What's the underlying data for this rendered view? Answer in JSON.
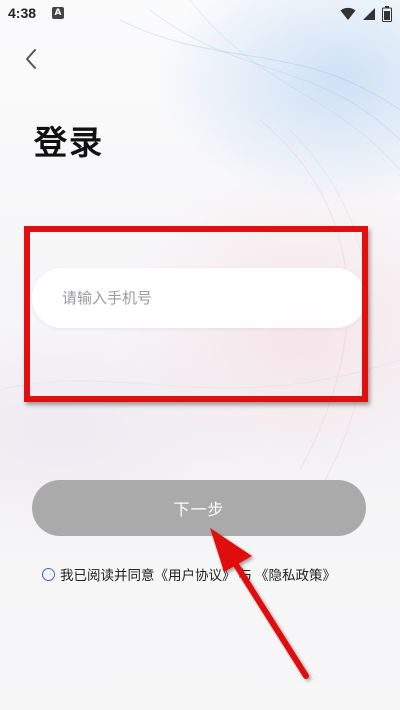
{
  "status_bar": {
    "time": "4:38",
    "notification_badge": "A",
    "icons": [
      "wifi-icon",
      "signal-icon",
      "battery-icon"
    ]
  },
  "header": {
    "back_icon": "chevron-left-icon",
    "title": "登录"
  },
  "phone_input": {
    "placeholder": "请输入手机号",
    "value": ""
  },
  "next_button": {
    "label": "下一步",
    "enabled": false,
    "color": "#aaaaab"
  },
  "agreement": {
    "checked": false,
    "prefix": "我已阅读并同意",
    "user_agreement": "《用户协议》",
    "conjunction": "与",
    "privacy_policy": "《隐私政策》"
  },
  "annotations": {
    "highlight_color": "#e01010",
    "arrow_color": "#e01010"
  }
}
